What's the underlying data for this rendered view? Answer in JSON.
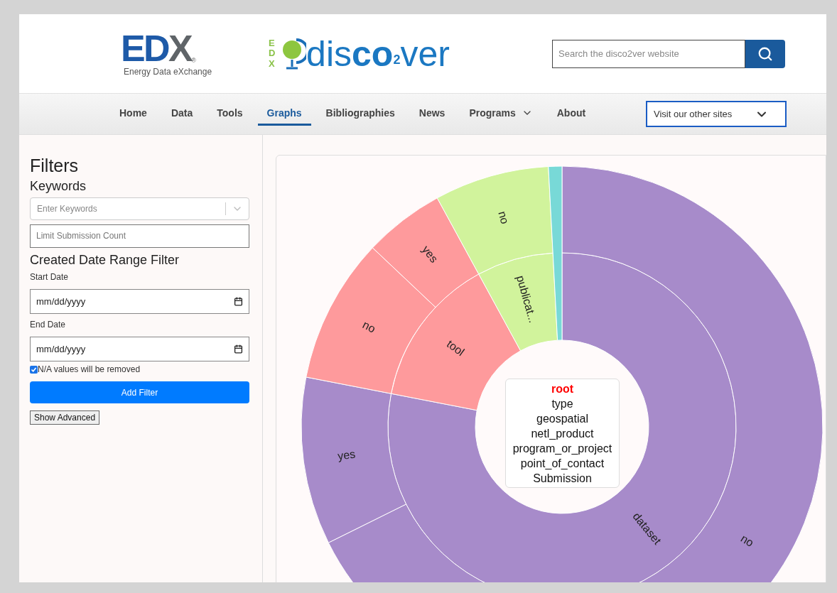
{
  "header": {
    "edx_logo": {
      "mark_parts": [
        "ED",
        "X"
      ],
      "registered": "®",
      "tagline": "Energy Data eXchange"
    },
    "discover_logo": {
      "badge": "EDX",
      "parts": [
        "dis",
        "co",
        "2",
        "ver"
      ]
    },
    "search": {
      "placeholder": "Search the disco2ver website"
    }
  },
  "nav": {
    "items": [
      {
        "label": "Home",
        "selected": false,
        "has_menu": false
      },
      {
        "label": "Data",
        "selected": false,
        "has_menu": false
      },
      {
        "label": "Tools",
        "selected": false,
        "has_menu": false
      },
      {
        "label": "Graphs",
        "selected": true,
        "has_menu": false
      },
      {
        "label": "Bibliographies",
        "selected": false,
        "has_menu": false
      },
      {
        "label": "News",
        "selected": false,
        "has_menu": false
      },
      {
        "label": "Programs",
        "selected": false,
        "has_menu": true
      },
      {
        "label": "About",
        "selected": false,
        "has_menu": false
      }
    ],
    "sites_dropdown": "Visit our other sites"
  },
  "filters": {
    "title": "Filters",
    "keywords_heading": "Keywords",
    "keywords_placeholder": "Enter Keywords",
    "limit_placeholder": "Limit Submission Count",
    "date_heading": "Created Date Range Filter",
    "start_label": "Start Date",
    "start_value": "mm/dd/yyyy",
    "end_label": "End Date",
    "end_value": "mm/dd/yyyy",
    "na_checkbox": {
      "label": "N/A values will be removed",
      "checked": true
    },
    "add_button": "Add Filter",
    "advanced_button": "Show Advanced"
  },
  "chart": {
    "segments": [
      {
        "label": "dataset",
        "color": "#a78bca",
        "children": [
          {
            "label": "no"
          },
          {
            "label": "yes"
          }
        ]
      },
      {
        "label": "tool",
        "color": "#fe9a9c",
        "children": [
          {
            "label": "no"
          },
          {
            "label": "yes"
          }
        ]
      },
      {
        "label": "publicat...",
        "color": "#d1f39c",
        "children": [
          {
            "label": "no"
          }
        ]
      },
      {
        "color": "#78d9d7"
      }
    ],
    "legend": {
      "current": "root",
      "levels": [
        "type",
        "geospatial",
        "netl_product",
        "program_or_project",
        "point_of_contact",
        "Submission"
      ]
    }
  }
}
